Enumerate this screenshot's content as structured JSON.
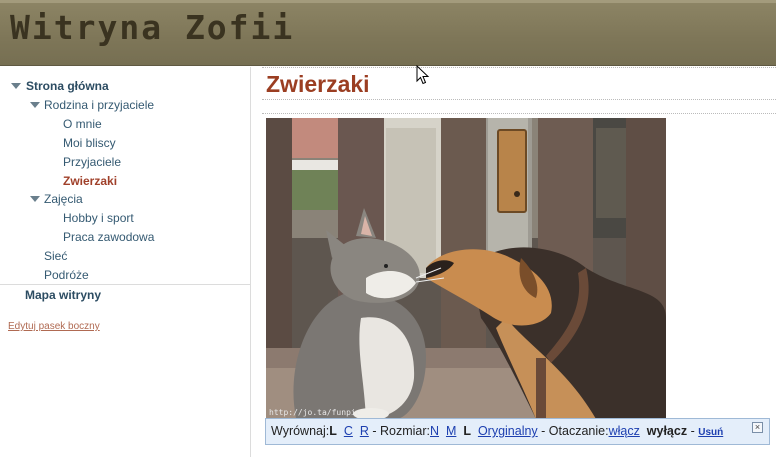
{
  "header": {
    "site_title": "Witryna Zofii"
  },
  "sidebar": {
    "home": "Strona główna",
    "family": "Rodzina i przyjaciele",
    "about_me": "O mnie",
    "relatives": "Moi bliscy",
    "friends": "Przyjaciele",
    "pets": "Zwierzaki",
    "activities": "Zajęcia",
    "hobby": "Hobby i sport",
    "work": "Praca zawodowa",
    "network": "Sieć",
    "travel": "Podróże",
    "sitemap": "Mapa witryny",
    "edit_sidebar": "Edytuj pasek boczny"
  },
  "main": {
    "page_title": "Zwierzaki",
    "image_watermark": "http://jo.ta/funpic"
  },
  "image_toolbar": {
    "align_label": "Wyrównaj:",
    "align_left": "L",
    "align_center": "C",
    "align_right": "R",
    "size_label": "- Rozmiar:",
    "size_small": "N",
    "size_medium": "M",
    "size_large": "L",
    "size_original": "Oryginalny",
    "wrap_label": "- Otaczanie:",
    "wrap_on": "włącz",
    "wrap_off": "wyłącz",
    "remove_sep": "-",
    "remove": "Usuń",
    "close_icon": "close-icon"
  },
  "colors": {
    "header_bg": "#7e7658",
    "title_color": "#9b3e22",
    "link_color": "#355a72",
    "active_color": "#a0402a",
    "toolbar_bg": "#e4eefa"
  }
}
